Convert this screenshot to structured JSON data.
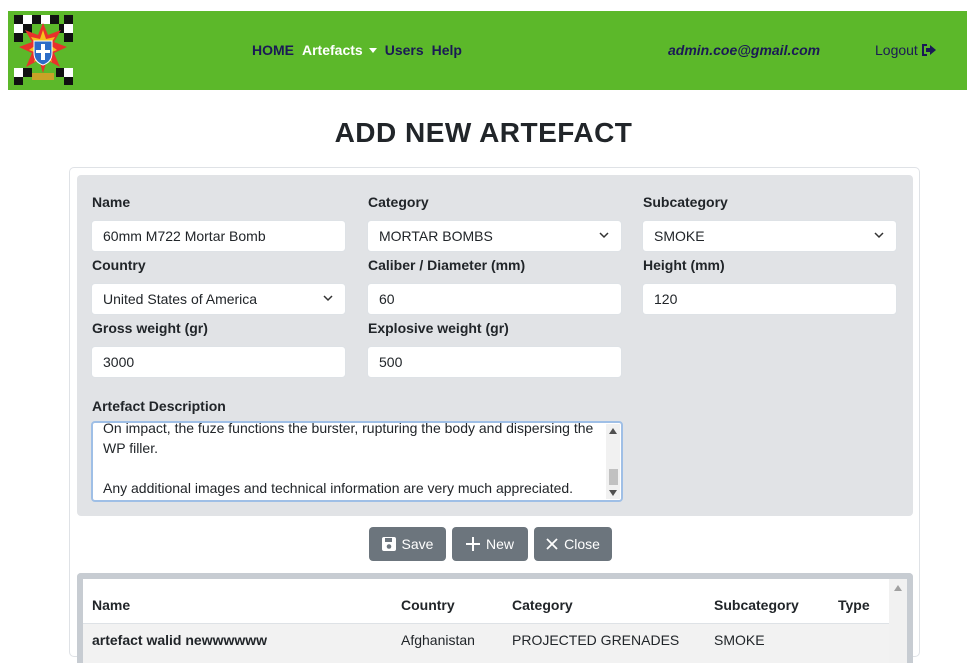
{
  "nav": {
    "links": [
      "HOME",
      "Artefacts",
      "Users",
      "Help"
    ],
    "user_email": "admin.coe@gmail.com",
    "logout_label": "Logout"
  },
  "page_title": "ADD NEW ARTEFACT",
  "form": {
    "name": {
      "label": "Name",
      "value": "60mm M722 Mortar Bomb"
    },
    "category": {
      "label": "Category",
      "value": "MORTAR BOMBS"
    },
    "subcategory": {
      "label": "Subcategory",
      "value": "SMOKE"
    },
    "country": {
      "label": "Country",
      "value": "United States of America"
    },
    "caliber": {
      "label": "Caliber / Diameter (mm)",
      "value": "60"
    },
    "height": {
      "label": "Height (mm)",
      "value": "120"
    },
    "gross_weight": {
      "label": "Gross weight (gr)",
      "value": "3000"
    },
    "explosive_weight": {
      "label": "Explosive weight (gr)",
      "value": "500"
    },
    "description": {
      "label": "Artefact Description",
      "value": "On impact, the fuze functions the burster, rupturing the body and dispersing the WP filler.\n\nAny additional images and technical information are very much appreciated."
    }
  },
  "buttons": {
    "save": "Save",
    "new": "New",
    "close": "Close"
  },
  "table": {
    "headers": [
      "Name",
      "Country",
      "Category",
      "Subcategory",
      "Type"
    ],
    "rows": [
      [
        "artefact walid newwwwww",
        "Afghanistan",
        "PROJECTED GRENADES",
        "SMOKE",
        ""
      ]
    ]
  },
  "colors": {
    "navbar": "#5cb82a",
    "nav_link": "#1a1a55",
    "button": "#6c757d",
    "panel": "#e1e3e6"
  }
}
